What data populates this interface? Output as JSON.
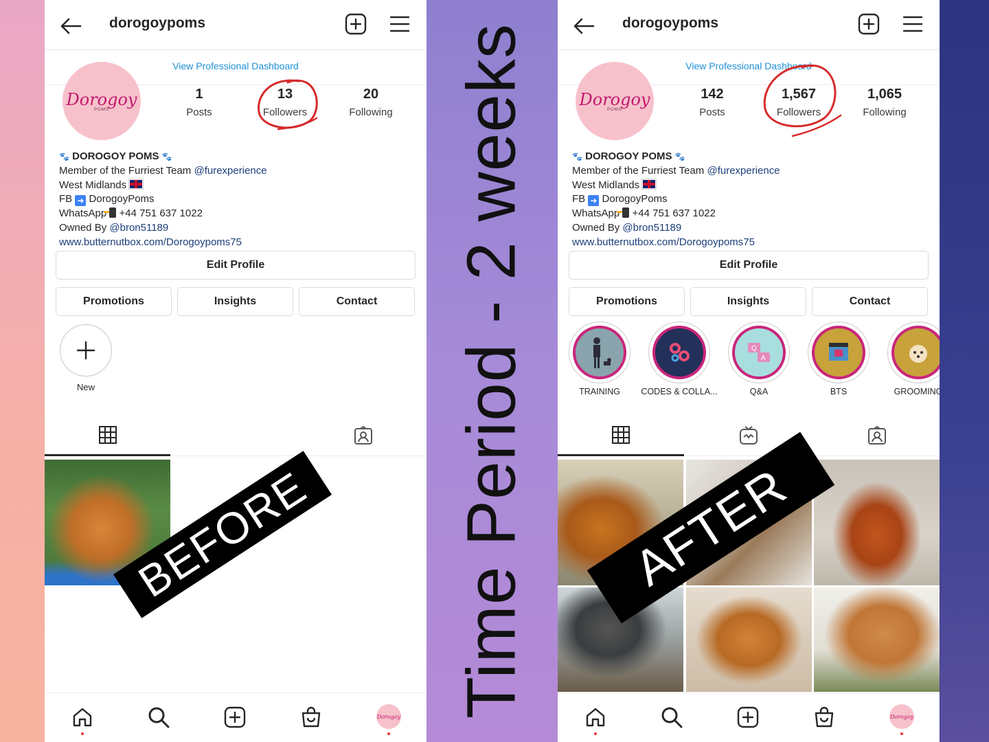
{
  "center_caption": "Time Period - 2 weeks",
  "before": {
    "banner": "BEFORE",
    "username": "dorogoypoms",
    "dashboard_link": "View Professional Dashboard",
    "avatar_text": "Dorogoy",
    "avatar_sub": "POMS",
    "stats": [
      {
        "num": "1",
        "label": "Posts"
      },
      {
        "num": "13",
        "label": "Followers"
      },
      {
        "num": "20",
        "label": "Following"
      }
    ],
    "bio": {
      "name": "DOROGOY POMS",
      "line1_text": "Member of the Furriest Team ",
      "line1_mention": "@furexperience",
      "line2": "West Midlands",
      "line3_prefix": "FB",
      "line3_text": "DorogoyPoms",
      "line4_prefix": "WhatsApp",
      "line4_text": "+44 751 637 1022",
      "line5_text": "Owned By ",
      "line5_mention": "@bron51189",
      "website": "www.butternutbox.com/Dorogoypoms75"
    },
    "buttons": {
      "edit": "Edit Profile",
      "promotions": "Promotions",
      "insights": "Insights",
      "contact": "Contact"
    },
    "new_highlight_label": "New"
  },
  "after": {
    "banner": "AFTER",
    "username": "dorogoypoms",
    "dashboard_link": "View Professional Dashboard",
    "avatar_text": "Dorogoy",
    "avatar_sub": "POMS",
    "stats": [
      {
        "num": "142",
        "label": "Posts"
      },
      {
        "num": "1,567",
        "label": "Followers"
      },
      {
        "num": "1,065",
        "label": "Following"
      }
    ],
    "bio": {
      "name": "DOROGOY POMS",
      "line1_text": "Member of the Furriest Team ",
      "line1_mention": "@furexperience",
      "line2": "West Midlands",
      "line3_prefix": "FB",
      "line3_text": "DorogoyPoms",
      "line4_prefix": "WhatsApp",
      "line4_text": "+44 751 637 1022",
      "line5_text": "Owned By ",
      "line5_mention": "@bron51189",
      "website": "www.butternutbox.com/Dorogoypoms75"
    },
    "buttons": {
      "edit": "Edit Profile",
      "promotions": "Promotions",
      "insights": "Insights",
      "contact": "Contact"
    },
    "highlights": [
      "TRAINING",
      "CODES & COLLA...",
      "Q&A",
      "BTS",
      "GROOMING"
    ]
  },
  "colors": {
    "accent_link": "#1e90d6",
    "mention": "#1b3e7a",
    "highlight_ring": "#c9257c",
    "circle_annotation": "#d62a2a"
  },
  "icons": [
    "back-arrow-icon",
    "add-post-icon",
    "menu-icon",
    "grid-icon",
    "tagged-icon",
    "reels-icon",
    "home-icon",
    "search-icon",
    "shop-icon"
  ]
}
